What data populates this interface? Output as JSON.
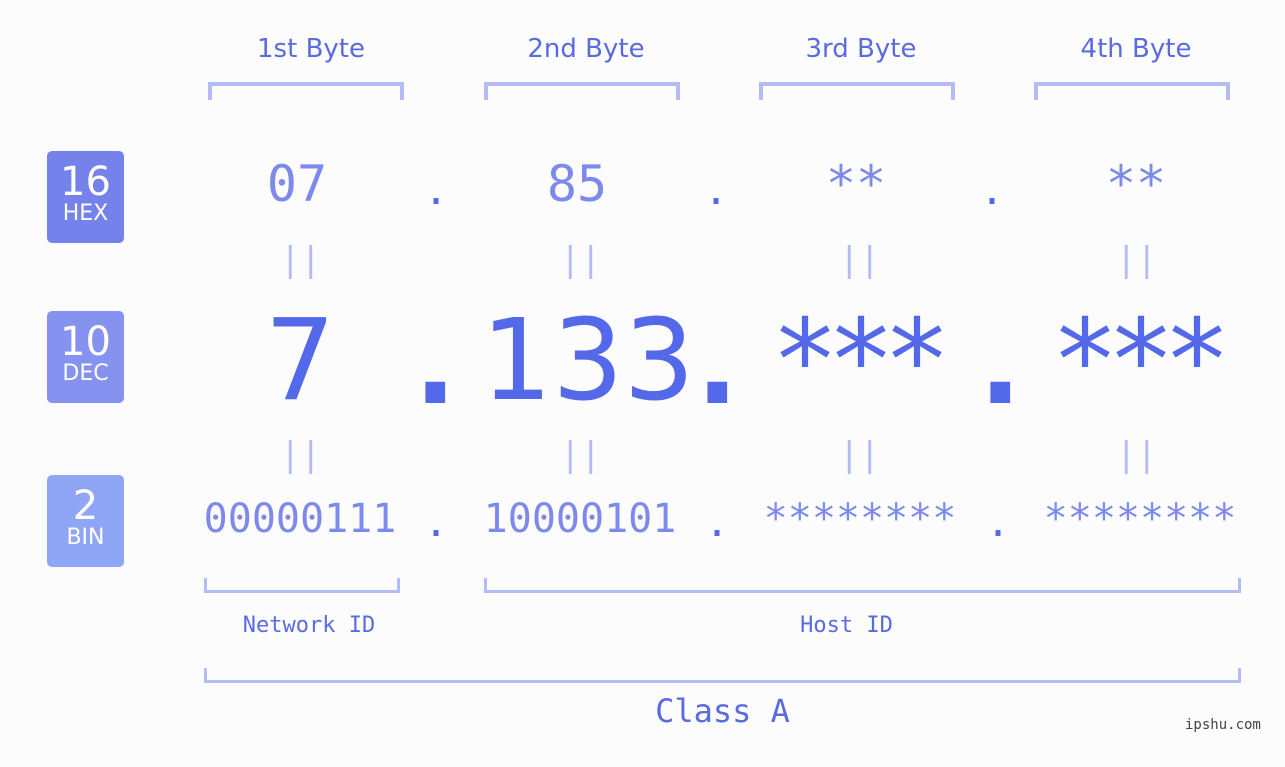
{
  "headers": [
    "1st Byte",
    "2nd Byte",
    "3rd Byte",
    "4th Byte"
  ],
  "badges": [
    {
      "num": "16",
      "label": "HEX",
      "color": "#7582eb"
    },
    {
      "num": "10",
      "label": "DEC",
      "color": "#8592ef"
    },
    {
      "num": "2",
      "label": "BIN",
      "color": "#8ea6f5"
    }
  ],
  "hex": [
    "07",
    "85",
    "**",
    "**"
  ],
  "dec": [
    "7",
    "133",
    "***",
    "***"
  ],
  "bin": [
    "00000111",
    "10000101",
    "********",
    "********"
  ],
  "separator": ".",
  "equals": "||",
  "network_label": "Network ID",
  "host_label": "Host ID",
  "class_label": "Class A",
  "watermark": "ipshu.com"
}
